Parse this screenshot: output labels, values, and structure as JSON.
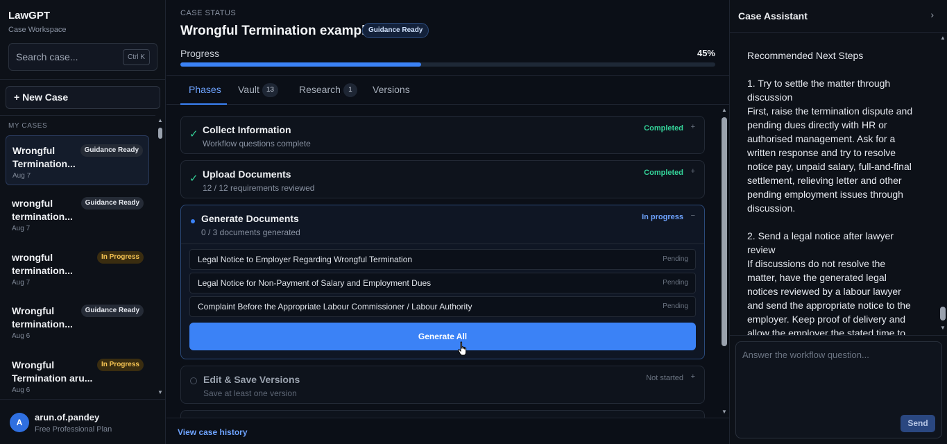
{
  "sidebar": {
    "brand_title": "LawGPT",
    "brand_subtitle": "Case Workspace",
    "search_placeholder": "Search case...",
    "search_shortcut": "Ctrl K",
    "new_case_label": "+ New Case",
    "cases_label": "MY CASES",
    "cases": [
      {
        "title": "Wrongful Termination...",
        "date": "Aug 7",
        "badge": "Guidance Ready",
        "active": true
      },
      {
        "title": "wrongful termination...",
        "date": "Aug 7",
        "badge": "Guidance Ready",
        "active": false
      },
      {
        "title": "wrongful termination...",
        "date": "Aug 7",
        "badge": "In Progress",
        "active": false
      },
      {
        "title": "Wrongful termination...",
        "date": "Aug 6",
        "badge": "Guidance Ready",
        "active": false
      },
      {
        "title": "Wrongful Termination aru...",
        "date": "Aug 6",
        "badge": "In Progress",
        "active": false
      }
    ],
    "user": {
      "initial": "A",
      "name": "arun.of.pandey",
      "plan": "Free Professional Plan"
    }
  },
  "main": {
    "status_label": "CASE STATUS",
    "case_title": "Wrongful Termination example",
    "case_badge": "Guidance Ready",
    "progress_label": "Progress",
    "progress_value": "45%",
    "progress_fraction": 0.45,
    "tabs": [
      {
        "label": "Phases",
        "count": null,
        "active": true
      },
      {
        "label": "Vault",
        "count": "13",
        "active": false
      },
      {
        "label": "Research",
        "count": "1",
        "active": false
      },
      {
        "label": "Versions",
        "count": null,
        "active": false
      }
    ],
    "phases": [
      {
        "title": "Collect Information",
        "subtitle": "Workflow questions complete",
        "status": "Completed",
        "toggle": "+"
      },
      {
        "title": "Upload Documents",
        "subtitle": "12 / 12 requirements reviewed",
        "status": "Completed",
        "toggle": "+"
      },
      {
        "title": "Generate Documents",
        "subtitle": "0 / 3 documents generated",
        "status": "In progress",
        "toggle": "−",
        "documents": [
          {
            "name": "Legal Notice to Employer Regarding Wrongful Termination",
            "state": "Pending"
          },
          {
            "name": "Legal Notice for Non-Payment of Salary and Employment Dues",
            "state": "Pending"
          },
          {
            "name": "Complaint Before the Appropriate Labour Commissioner / Labour Authority",
            "state": "Pending"
          }
        ],
        "action_label": "Generate All"
      },
      {
        "title": "Edit & Save Versions",
        "subtitle": "Save at least one version",
        "status": "Not started",
        "toggle": "+"
      }
    ],
    "history_link": "View case history"
  },
  "assistant": {
    "title": "Case Assistant",
    "messages": [
      "Recommended Next Steps",
      "1. Try to settle the matter through discussion\nFirst, raise the termination dispute and pending dues directly with HR or authorised management. Ask for a written response and try to resolve notice pay, unpaid salary, full-and-final settlement, relieving letter and other pending employment issues through discussion.",
      "2. Send a legal notice after lawyer review\nIf discussions do not resolve the matter, have the generated legal notices reviewed by a labour lawyer and send the appropriate notice to the employer. Keep proof of delivery and allow the employer the stated time to"
    ],
    "input_placeholder": "Answer the workflow question...",
    "send_label": "Send"
  },
  "colors": {
    "accent": "#3b82f6",
    "completed": "#34d399",
    "in_progress_badge": "#f6c453",
    "background": "#0b0f17"
  }
}
